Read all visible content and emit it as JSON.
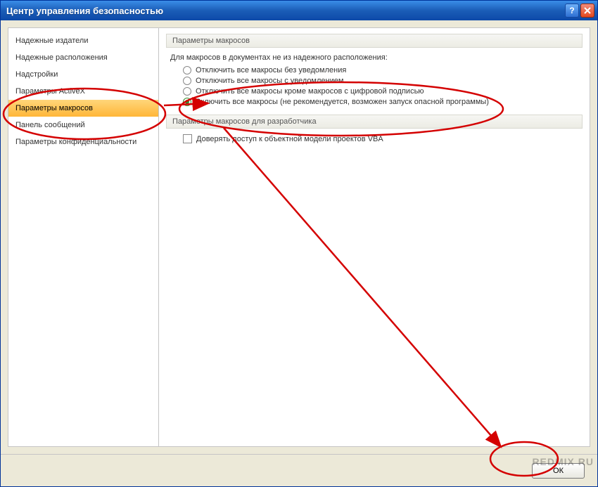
{
  "window": {
    "title": "Центр управления безопасностью"
  },
  "sidebar": {
    "items": [
      {
        "label": "Надежные издатели"
      },
      {
        "label": "Надежные расположения"
      },
      {
        "label": "Надстройки"
      },
      {
        "label": "Параметры ActiveX"
      },
      {
        "label": "Параметры макросов"
      },
      {
        "label": "Панель сообщений"
      },
      {
        "label": "Параметры конфиденциальности"
      }
    ],
    "selected_index": 4
  },
  "content": {
    "section1_title": "Параметры макросов",
    "section1_desc": "Для макросов в документах не из надежного расположения:",
    "radios": [
      {
        "label": "Отключить все макросы без уведомления"
      },
      {
        "label": "Отключить все макросы с уведомлением"
      },
      {
        "label": "Отключить все макросы кроме макросов с цифровой подписью"
      },
      {
        "label": "Включить все макросы (не рекомендуется, возможен запуск опасной программы)"
      }
    ],
    "radio_selected_index": 3,
    "section2_title": "Параметры макросов для разработчика",
    "checkbox1_label": "Доверять доступ к объектной модели проектов VBA",
    "checkbox1_checked": false
  },
  "footer": {
    "ok_label": "ОК"
  },
  "watermark": "REDMIX RU"
}
